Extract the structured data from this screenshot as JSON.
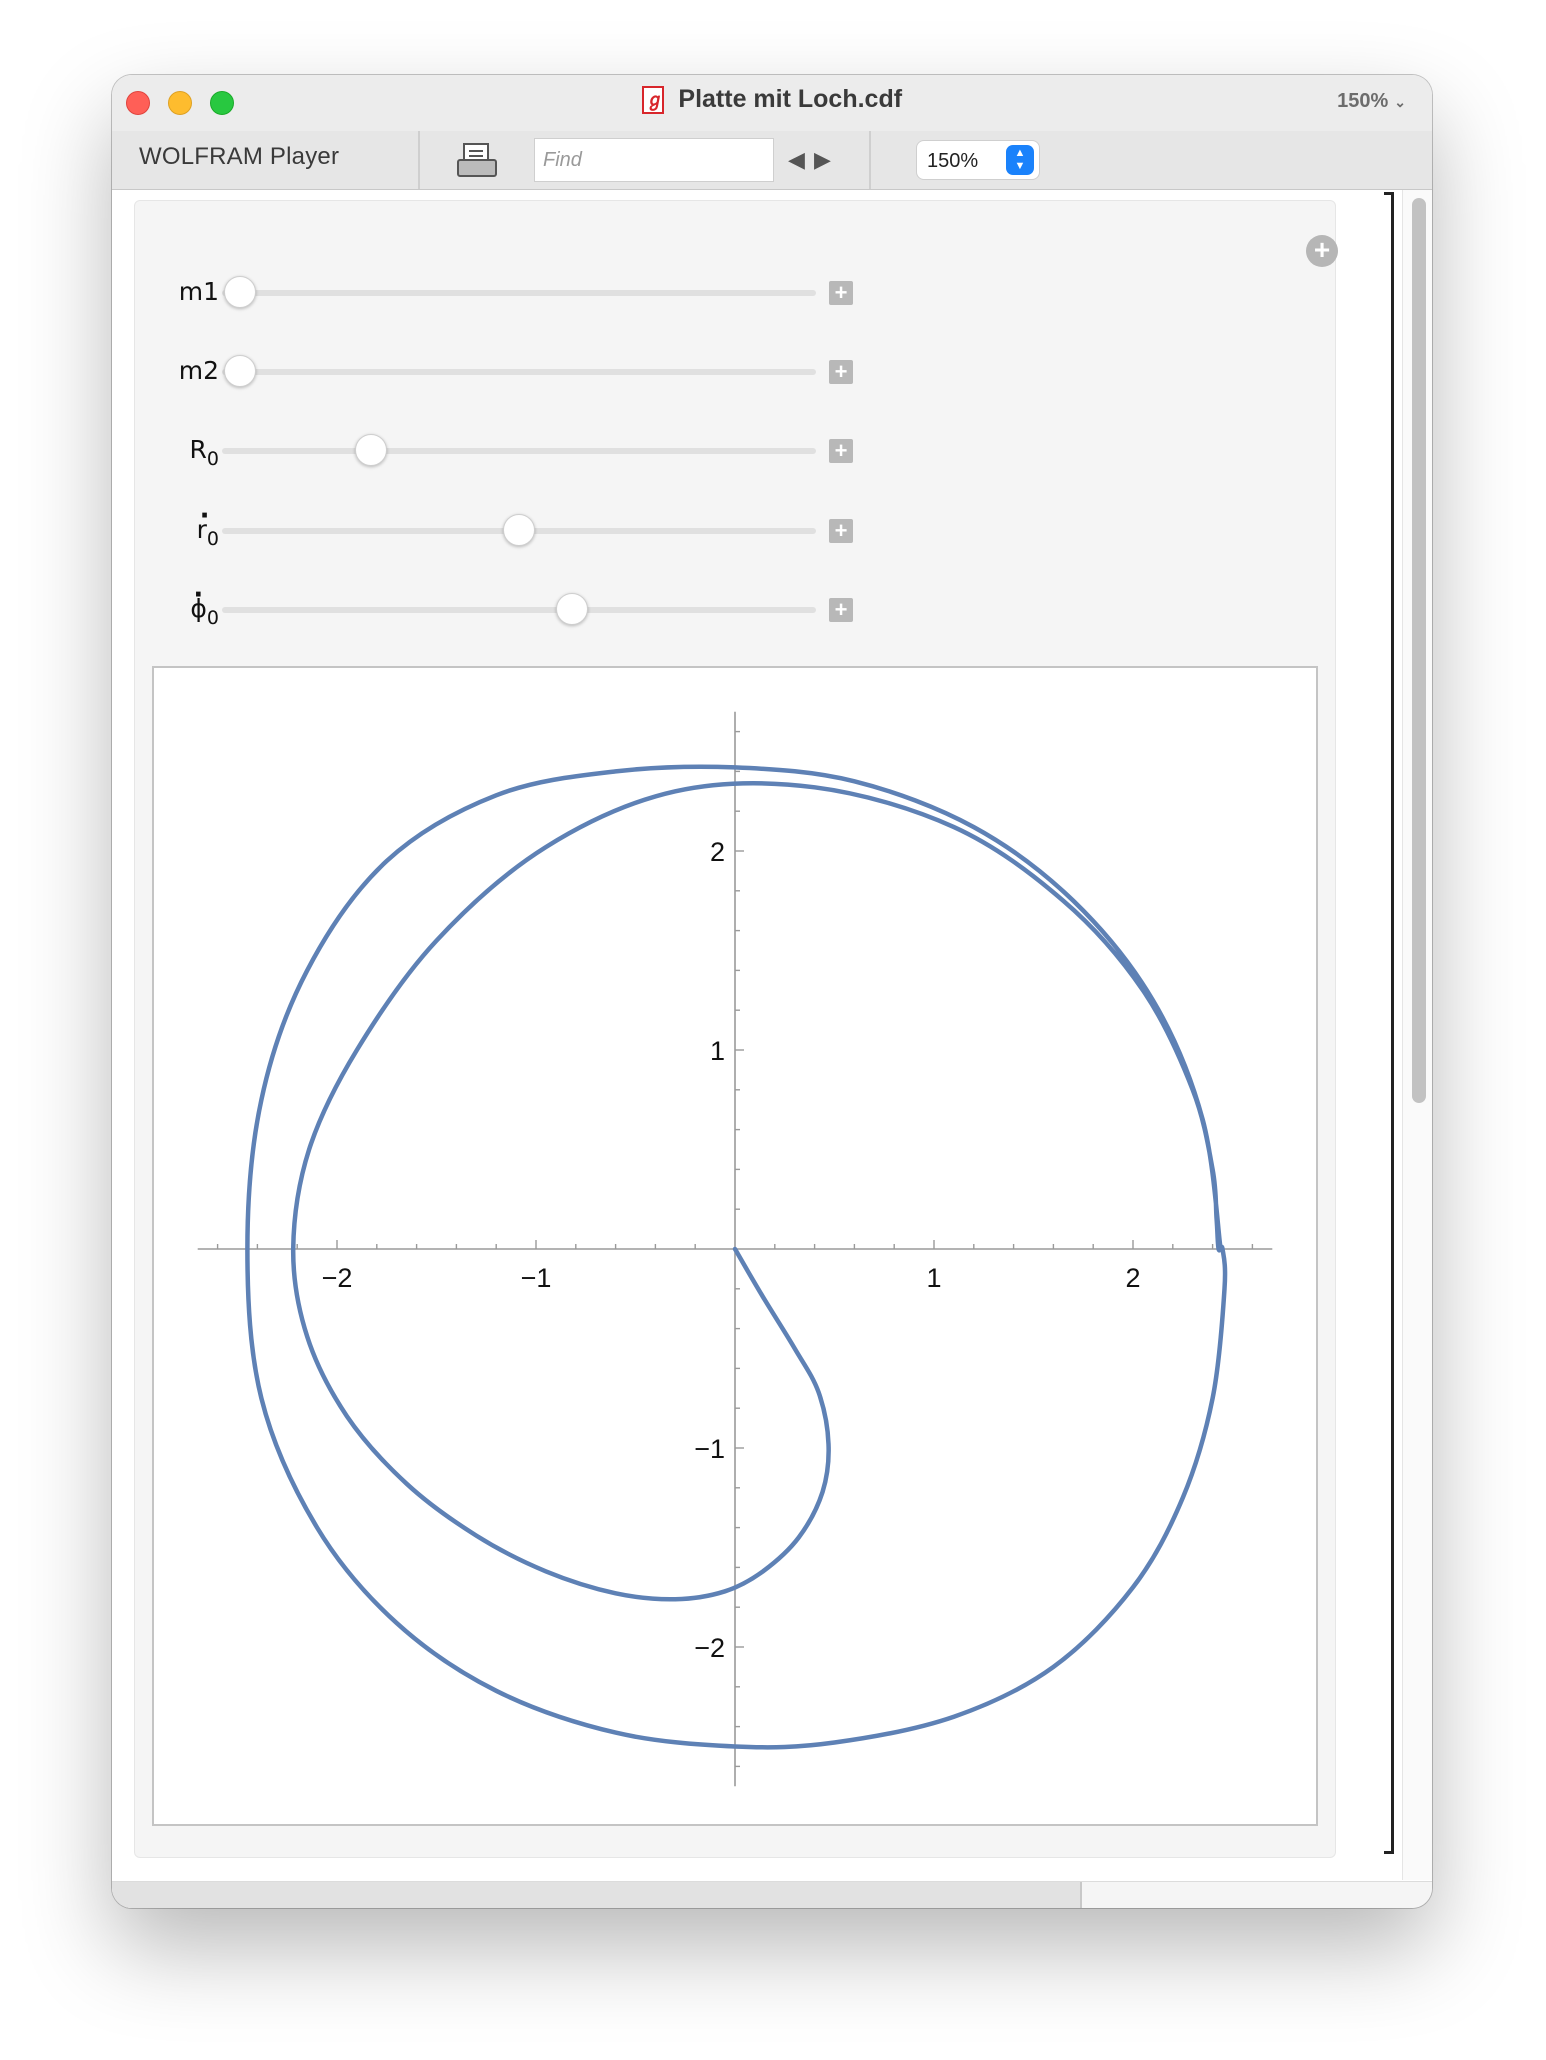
{
  "window": {
    "title": "Platte mit Loch.cdf",
    "zoom_indicator": "150%"
  },
  "toolbar": {
    "brand": "WOLFRAM Player",
    "find_placeholder": "Find",
    "prev_arrow": "◀",
    "next_arrow": "▶",
    "zoom_value": "150%"
  },
  "icons": {
    "doc": "cdf-document-icon",
    "print": "print-icon",
    "add_circle": "plus-circle-icon",
    "slider_plus": "plus-square-icon"
  },
  "controls": [
    {
      "label": "m1",
      "sub": "",
      "dot": "",
      "value": 0.03
    },
    {
      "label": "m2",
      "sub": "",
      "dot": "",
      "value": 0.03
    },
    {
      "label": "R",
      "sub": "0",
      "dot": "",
      "value": 0.25
    },
    {
      "label": "r",
      "sub": "0",
      "dot": "·",
      "value": 0.5
    },
    {
      "label": "ϕ",
      "sub": "0",
      "dot": "·",
      "value": 0.59
    }
  ],
  "chart_data": {
    "type": "line",
    "title": "",
    "xlabel": "",
    "ylabel": "",
    "xlim": [
      -2.7,
      2.7
    ],
    "ylim": [
      -2.7,
      2.7
    ],
    "x_ticks": [
      -2,
      -1,
      1,
      2
    ],
    "y_ticks": [
      -2,
      -1,
      1,
      2
    ],
    "x_tick_labels": [
      "−2",
      "−1",
      "1",
      "2"
    ],
    "y_tick_labels": [
      "−2",
      "−1",
      "1",
      "2"
    ],
    "grid": false,
    "series": [
      {
        "color": "#5e81b5",
        "x": [
          0.0,
          0.14,
          0.3,
          0.42,
          0.47,
          0.44,
          0.32,
          0.14,
          -0.05,
          -0.3,
          -0.6,
          -0.95,
          -1.3,
          -1.65,
          -1.95,
          -2.15,
          -2.22,
          -2.14,
          -1.9,
          -1.5,
          -0.95,
          -0.3,
          0.4,
          1.1,
          1.65,
          2.05,
          2.3,
          2.4,
          2.42,
          2.43,
          2.45,
          2.46,
          2.4,
          2.25,
          2.0,
          1.6,
          1.1,
          0.5,
          0.0,
          -0.6,
          -1.2,
          -1.7,
          -2.1,
          -2.38,
          -2.45,
          -2.38,
          -2.15,
          -1.75,
          -1.2,
          -0.6,
          0.0,
          0.6,
          1.2,
          1.7,
          2.1,
          2.35,
          2.44
        ],
        "y": [
          0.0,
          -0.24,
          -0.5,
          -0.72,
          -0.98,
          -1.22,
          -1.45,
          -1.62,
          -1.72,
          -1.76,
          -1.73,
          -1.62,
          -1.44,
          -1.18,
          -0.84,
          -0.44,
          0.0,
          0.5,
          1.0,
          1.55,
          2.02,
          2.3,
          2.32,
          2.12,
          1.75,
          1.3,
          0.8,
          0.4,
          0.15,
          0.0,
          0.0,
          -0.2,
          -0.75,
          -1.25,
          -1.7,
          -2.1,
          -2.35,
          -2.48,
          -2.5,
          -2.43,
          -2.22,
          -1.88,
          -1.4,
          -0.75,
          0.0,
          0.75,
          1.4,
          1.95,
          2.28,
          2.4,
          2.42,
          2.35,
          2.12,
          1.75,
          1.25,
          0.65,
          0.0
        ]
      }
    ]
  }
}
